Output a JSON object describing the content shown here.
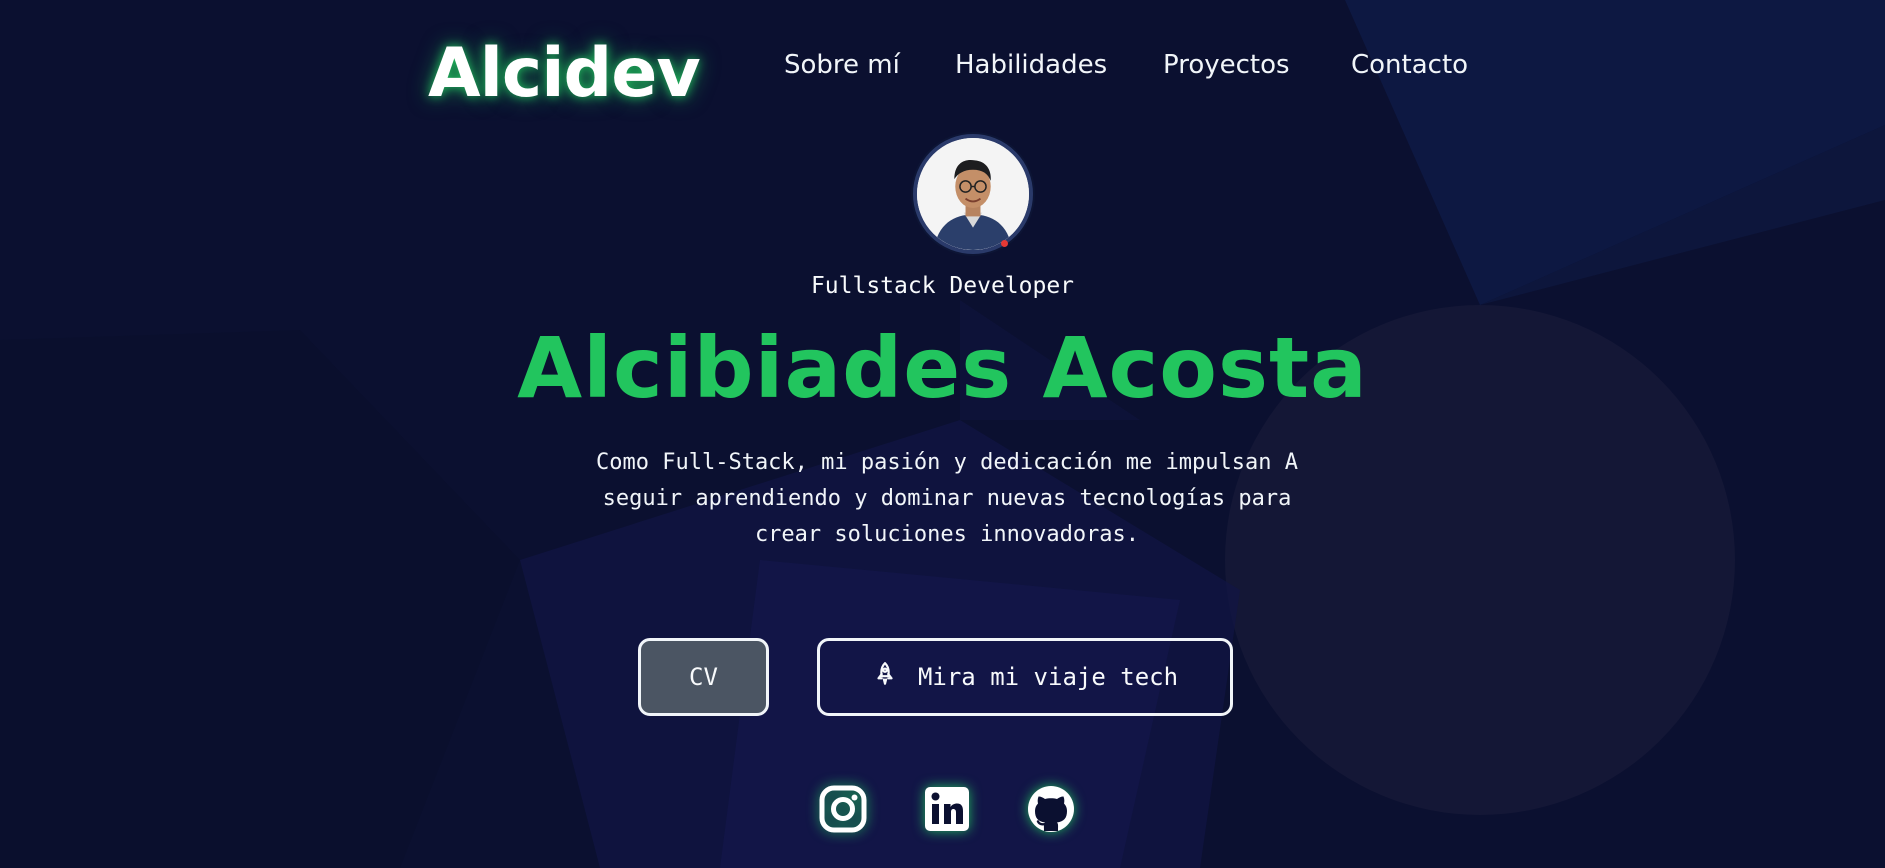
{
  "header": {
    "logo": "Alcidev",
    "nav": [
      {
        "label": "Sobre mí"
      },
      {
        "label": "Habilidades"
      },
      {
        "label": "Proyectos"
      },
      {
        "label": "Contacto"
      }
    ]
  },
  "hero": {
    "role": "Fullstack Developer",
    "name": "Alcibiades Acosta",
    "description": "Como Full-Stack, mi pasión y dedicación me impulsan A seguir aprendiendo y dominar nuevas tecnologías para crear soluciones innovadoras.",
    "cv_button": "CV",
    "tech_button": "Mira mi viaje tech",
    "tech_button_icon": "rocket-icon"
  },
  "socials": [
    {
      "icon": "instagram-icon"
    },
    {
      "icon": "linkedin-icon"
    },
    {
      "icon": "github-icon"
    }
  ],
  "colors": {
    "background": "#0b1030",
    "accent": "#22c55e",
    "cv_button_bg": "#4b5563",
    "text": "#f8fafc"
  }
}
